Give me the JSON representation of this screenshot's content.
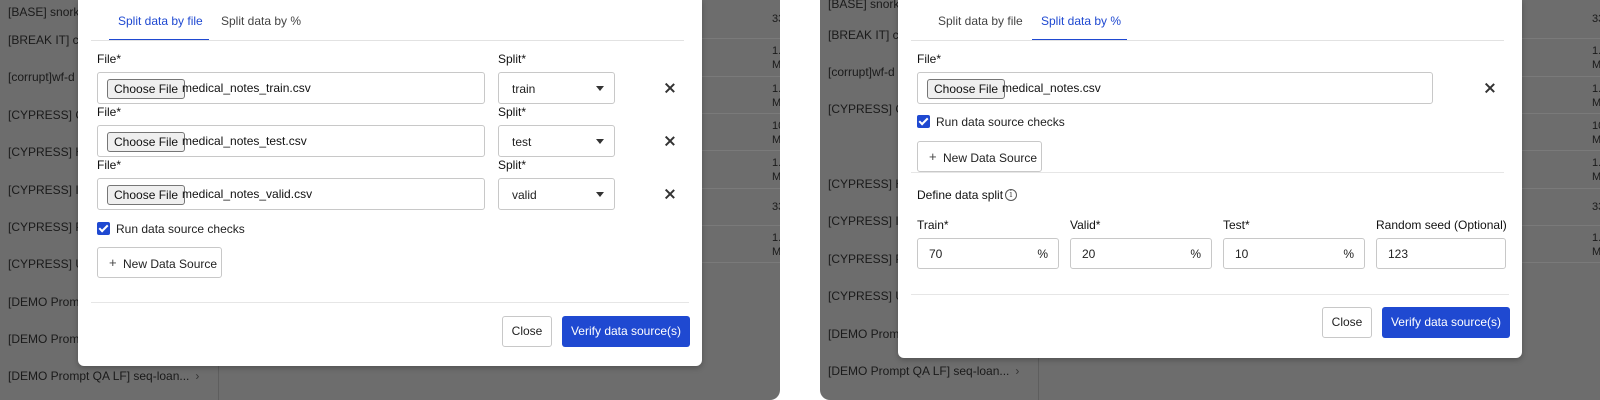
{
  "left_background": {
    "list_items": [
      "[BASE] snorke",
      "[BREAK IT] co",
      "[corrupt]wf-d",
      "[CYPRESS] CC",
      "[CYPRESS] HI",
      "[CYPRESS] IM",
      "[CYPRESS] PD",
      "[CYPRESS] UT",
      "[DEMO Prompt",
      "[DEMO Promp",
      "[DEMO Prompt QA LF] seq-loan..."
    ],
    "cells": [
      "33",
      "1.",
      "M",
      "1.",
      "M",
      "10",
      "M",
      "1.",
      "M",
      "33",
      "1.",
      "M",
      "1.",
      "M"
    ]
  },
  "right_background": {
    "list_items": [
      "[BASE] snorke",
      "[BREAK IT] co",
      "[corrupt]wf-d",
      "[CYPRESS] CC",
      "[CYPRESS] HI",
      "[CYPRESS] IM",
      "[CYPRESS] PD",
      "[CYPRESS] UT",
      "[DEMO Prompt",
      "[DEMO Prompt QA LF] seq-loan..."
    ],
    "cells": [
      "33",
      "1.",
      "M",
      "1.",
      "M",
      "10",
      "M",
      "1.",
      "M",
      "33",
      "1.",
      "M",
      "1.",
      "M"
    ]
  },
  "left_modal": {
    "tabs": [
      {
        "label": "Split data by file",
        "active": true
      },
      {
        "label": "Split data by %",
        "active": false
      }
    ],
    "file_rows": [
      {
        "file_label": "File*",
        "split_label": "Split*",
        "choose_label": "Choose File",
        "file_name": "medical_notes_train.csv",
        "split_value": "train"
      },
      {
        "file_label": "File*",
        "split_label": "Split*",
        "choose_label": "Choose File",
        "file_name": "medical_notes_test.csv",
        "split_value": "test"
      },
      {
        "file_label": "File*",
        "split_label": "Split*",
        "choose_label": "Choose File",
        "file_name": "medical_notes_valid.csv",
        "split_value": "valid"
      }
    ],
    "run_checks_label": "Run data source checks",
    "run_checks_checked": true,
    "new_source_label": "New Data Source",
    "close_label": "Close",
    "verify_label": "Verify data source(s)"
  },
  "right_modal": {
    "tabs": [
      {
        "label": "Split data by file",
        "active": false
      },
      {
        "label": "Split data by %",
        "active": true
      }
    ],
    "file_label": "File*",
    "choose_label": "Choose File",
    "file_name": "medical_notes.csv",
    "run_checks_label": "Run data source checks",
    "run_checks_checked": true,
    "new_source_label": "New Data Source",
    "define_split_label": "Define data split",
    "fields": [
      {
        "label": "Train*",
        "value": "70",
        "unit": "%"
      },
      {
        "label": "Valid*",
        "value": "20",
        "unit": "%"
      },
      {
        "label": "Test*",
        "value": "10",
        "unit": "%"
      },
      {
        "label": "Random seed (Optional)",
        "value": "123",
        "unit": ""
      }
    ],
    "close_label": "Close",
    "verify_label": "Verify data source(s)"
  },
  "colors": {
    "accent": "#1f49d1",
    "overlay": "#6d6d6d"
  }
}
